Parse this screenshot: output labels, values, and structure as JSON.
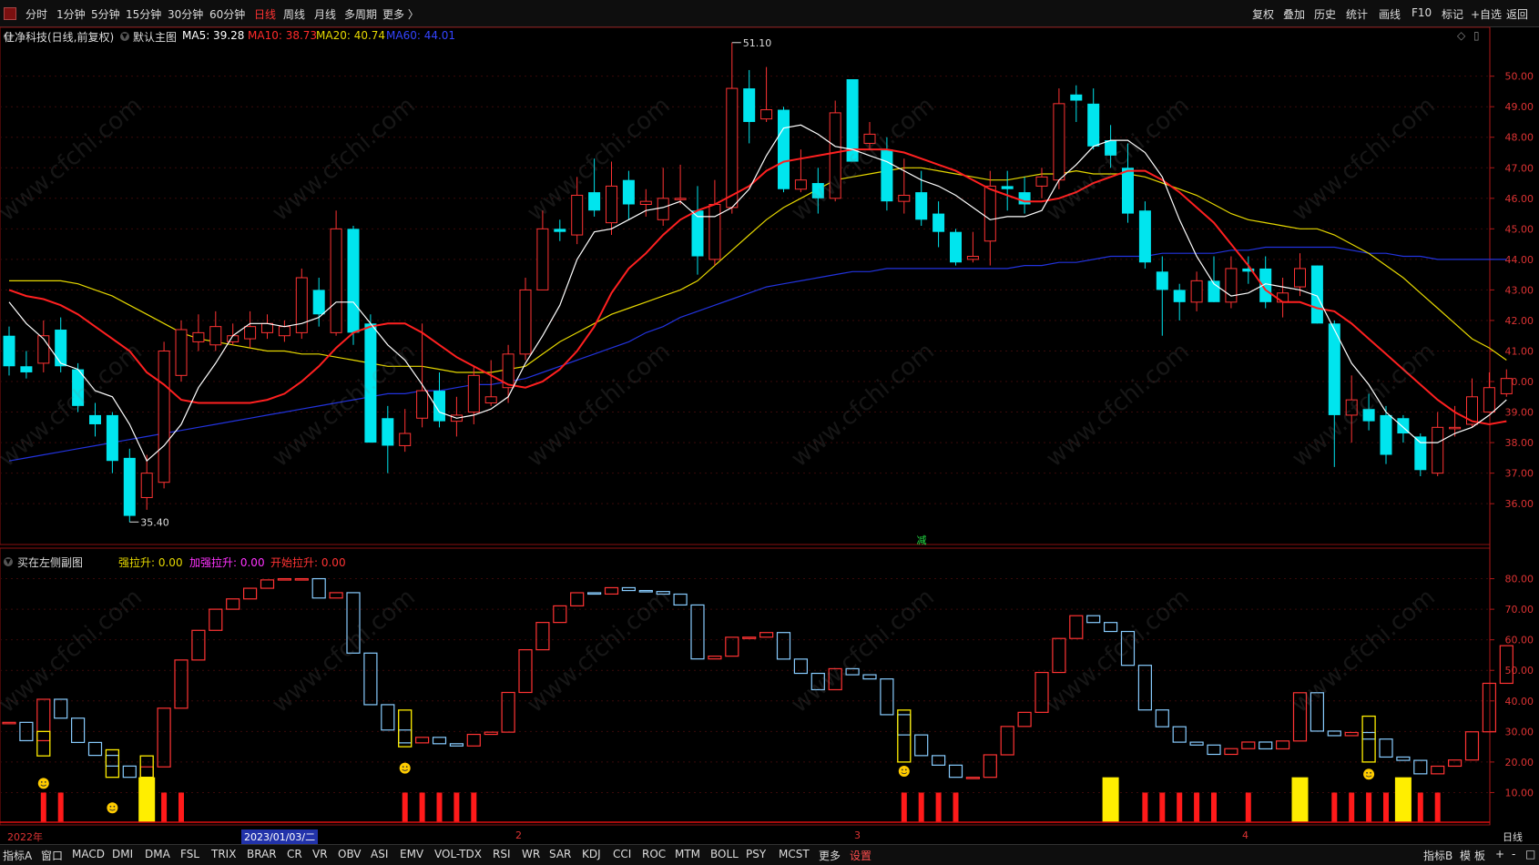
{
  "toolbar": {
    "periods": [
      "分时",
      "1分钟",
      "5分钟",
      "15分钟",
      "30分钟",
      "60分钟",
      "日线",
      "周线",
      "月线",
      "多周期",
      "更多 〉"
    ],
    "active_period": "日线",
    "right_buttons": [
      "复权",
      "叠加",
      "历史",
      "统计",
      "画线",
      "F10",
      "标记",
      "+自选",
      "返回"
    ]
  },
  "main_panel": {
    "stock_title": "仕净科技(日线,前复权)",
    "template": "默认主图",
    "ma5": "MA5: 39.28",
    "ma10": "MA10: 38.73",
    "ma20": "MA20: 40.74",
    "ma60": "MA60: 44.01",
    "high_label": "51.10",
    "low_label": "35.40",
    "marker": "减",
    "y_ticks": [
      "50.00",
      "49.00",
      "48.00",
      "47.00",
      "46.00",
      "45.00",
      "44.00",
      "43.00",
      "42.00",
      "41.00",
      "40.00",
      "39.00",
      "38.00",
      "37.00",
      "36.00"
    ]
  },
  "sub_panel": {
    "title": "买在左侧副图",
    "strong": "强拉升: 0.00",
    "accel": "加强拉升: 0.00",
    "start": "开始拉升: 0.00",
    "y_ticks": [
      "80.00",
      "70.00",
      "60.00",
      "50.00",
      "40.00",
      "30.00",
      "20.00",
      "10.00"
    ]
  },
  "date_axis": {
    "labels": [
      "2022年",
      "2023/01/03/二",
      "2",
      "3",
      "4"
    ],
    "right_label": "日线"
  },
  "bottom_tabs": {
    "items": [
      "指标A",
      "窗口",
      "MACD",
      "DMI",
      "DMA",
      "FSL",
      "TRIX",
      "BRAR",
      "CR",
      "VR",
      "OBV",
      "ASI",
      "EMV",
      "VOL-TDX",
      "RSI",
      "WR",
      "SAR",
      "KDJ",
      "CCI",
      "ROC",
      "MTM",
      "BOLL",
      "PSY",
      "MCST",
      "更多",
      "设置"
    ],
    "right_items": [
      "指标B",
      "模",
      "板",
      "+",
      "-",
      "□"
    ]
  },
  "colors": {
    "up": "#ff3333",
    "down": "#00e5ee",
    "ma5": "#ffffff",
    "ma10": "#ff2020",
    "ma20": "#e6d800",
    "ma60": "#2233dd"
  },
  "watermark": "www.cfchi.com",
  "chart_data": {
    "type": "candlestick",
    "candles": [
      [
        41.5,
        40.5,
        41.8,
        40.2
      ],
      [
        40.5,
        40.3,
        41.0,
        40.1
      ],
      [
        40.6,
        41.5,
        42.0,
        40.3
      ],
      [
        41.7,
        40.5,
        42.1,
        40.3
      ],
      [
        40.4,
        39.2,
        40.6,
        39.0
      ],
      [
        38.9,
        38.6,
        39.3,
        38.2
      ],
      [
        38.9,
        37.4,
        39.0,
        37.0
      ],
      [
        37.5,
        35.6,
        37.8,
        35.4
      ],
      [
        36.2,
        37.0,
        37.6,
        35.8
      ],
      [
        36.7,
        41.0,
        41.3,
        36.5
      ],
      [
        40.2,
        41.7,
        42.0,
        40.0
      ],
      [
        41.3,
        41.6,
        42.2,
        41.0
      ],
      [
        41.2,
        41.8,
        42.3,
        41.0
      ],
      [
        41.3,
        41.5,
        41.9,
        41.2
      ],
      [
        41.4,
        41.8,
        42.3,
        41.1
      ],
      [
        41.6,
        41.9,
        42.2,
        41.4
      ],
      [
        41.5,
        41.8,
        42.0,
        41.3
      ],
      [
        41.6,
        43.4,
        43.7,
        41.4
      ],
      [
        43.0,
        42.2,
        43.4,
        41.8
      ],
      [
        41.6,
        45.0,
        45.6,
        41.5
      ],
      [
        45.0,
        41.6,
        45.1,
        41.2
      ],
      [
        41.9,
        38.0,
        42.2,
        38.0
      ],
      [
        38.8,
        37.9,
        39.2,
        37.0
      ],
      [
        37.9,
        38.3,
        39.1,
        37.7
      ],
      [
        38.8,
        39.7,
        41.9,
        38.5
      ],
      [
        39.7,
        38.7,
        40.3,
        38.5
      ],
      [
        38.7,
        38.9,
        39.5,
        38.2
      ],
      [
        39.0,
        40.2,
        40.5,
        38.6
      ],
      [
        39.3,
        39.5,
        40.7,
        39.2
      ],
      [
        39.8,
        40.9,
        41.2,
        39.3
      ],
      [
        40.9,
        43.0,
        43.4,
        40.7
      ],
      [
        43.0,
        45.0,
        45.6,
        43.0
      ],
      [
        45.0,
        44.9,
        45.3,
        44.6
      ],
      [
        44.8,
        46.1,
        46.7,
        44.5
      ],
      [
        46.2,
        45.6,
        47.3,
        45.4
      ],
      [
        45.2,
        46.4,
        47.2,
        44.8
      ],
      [
        46.6,
        45.8,
        46.9,
        45.3
      ],
      [
        45.8,
        45.9,
        46.3,
        45.4
      ],
      [
        45.3,
        46.0,
        47.0,
        45.1
      ],
      [
        46.0,
        46.0,
        47.1,
        45.8
      ],
      [
        45.6,
        44.1,
        46.4,
        43.5
      ],
      [
        44.0,
        45.8,
        46.6,
        43.8
      ],
      [
        45.7,
        49.6,
        51.1,
        45.5
      ],
      [
        49.6,
        48.5,
        50.2,
        47.8
      ],
      [
        48.6,
        48.9,
        50.3,
        48.5
      ],
      [
        48.9,
        46.3,
        49.0,
        46.2
      ],
      [
        46.3,
        46.6,
        47.6,
        46.2
      ],
      [
        46.5,
        46.0,
        47.0,
        45.5
      ],
      [
        46.0,
        48.8,
        49.2,
        45.9
      ],
      [
        49.9,
        47.2,
        49.9,
        47.2
      ],
      [
        47.8,
        48.1,
        48.5,
        47.6
      ],
      [
        47.6,
        45.9,
        48.0,
        45.6
      ],
      [
        45.9,
        46.1,
        47.3,
        45.5
      ],
      [
        46.2,
        45.3,
        46.9,
        45.1
      ],
      [
        45.5,
        44.9,
        45.9,
        44.4
      ],
      [
        44.9,
        43.9,
        45.0,
        43.8
      ],
      [
        44.0,
        44.1,
        44.9,
        43.9
      ],
      [
        44.6,
        46.4,
        46.9,
        43.8
      ],
      [
        46.4,
        46.3,
        46.9,
        45.6
      ],
      [
        46.2,
        45.8,
        46.7,
        45.5
      ],
      [
        46.4,
        46.7,
        47.0,
        46.0
      ],
      [
        46.6,
        49.1,
        49.6,
        46.3
      ],
      [
        49.4,
        49.2,
        49.7,
        48.5
      ],
      [
        49.1,
        47.7,
        49.6,
        47.6
      ],
      [
        47.9,
        47.4,
        48.4,
        47.0
      ],
      [
        47.0,
        45.5,
        47.8,
        45.2
      ],
      [
        45.6,
        43.9,
        45.9,
        43.7
      ],
      [
        43.6,
        43.0,
        44.1,
        41.5
      ],
      [
        43.0,
        42.6,
        43.2,
        42.0
      ],
      [
        42.6,
        43.3,
        43.6,
        42.3
      ],
      [
        43.3,
        42.6,
        44.1,
        42.6
      ],
      [
        42.6,
        43.7,
        44.1,
        42.4
      ],
      [
        43.7,
        43.6,
        44.1,
        43.2
      ],
      [
        43.7,
        42.6,
        44.1,
        42.4
      ],
      [
        42.6,
        42.9,
        43.4,
        42.1
      ],
      [
        43.1,
        43.7,
        44.2,
        42.8
      ],
      [
        43.8,
        41.9,
        43.8,
        41.9
      ],
      [
        41.9,
        38.9,
        42.0,
        37.2
      ],
      [
        38.9,
        39.4,
        40.2,
        38.0
      ],
      [
        39.1,
        38.7,
        39.6,
        38.4
      ],
      [
        38.9,
        37.6,
        39.2,
        37.3
      ],
      [
        38.8,
        38.3,
        38.9,
        38.0
      ],
      [
        38.2,
        37.1,
        38.3,
        36.9
      ],
      [
        37.0,
        38.5,
        39.0,
        36.9
      ],
      [
        38.5,
        38.5,
        39.2,
        38.2
      ],
      [
        38.6,
        39.5,
        40.1,
        38.5
      ],
      [
        39.0,
        39.8,
        40.3,
        39.0
      ],
      [
        39.6,
        40.1,
        40.4,
        39.5
      ]
    ],
    "ma5": [
      42.6,
      41.9,
      41.4,
      40.6,
      40.4,
      39.7,
      39.5,
      38.6,
      37.4,
      37.9,
      38.6,
      39.8,
      40.6,
      41.5,
      41.9,
      41.9,
      41.8,
      41.9,
      42.1,
      42.6,
      42.6,
      41.9,
      41.2,
      40.7,
      39.9,
      39.0,
      38.8,
      38.9,
      39.1,
      39.5,
      40.6,
      41.5,
      42.5,
      44.0,
      44.9,
      45.0,
      45.3,
      45.6,
      45.7,
      45.9,
      45.4,
      45.4,
      45.7,
      46.3,
      47.4,
      48.3,
      48.4,
      48.1,
      47.7,
      47.6,
      47.4,
      47.2,
      46.9,
      46.6,
      46.4,
      46.1,
      45.7,
      45.3,
      45.4,
      45.4,
      45.6,
      46.6,
      47.1,
      47.7,
      47.9,
      47.9,
      47.5,
      46.7,
      45.3,
      44.1,
      43.2,
      42.8,
      42.9,
      43.2,
      43.1,
      43.0,
      42.8,
      41.7,
      40.6,
      39.9,
      39.0,
      38.5,
      38.0,
      38.0,
      38.3,
      38.5,
      38.9,
      39.4
    ],
    "ma10": [
      43.0,
      42.8,
      42.7,
      42.5,
      42.2,
      41.8,
      41.4,
      41.0,
      40.3,
      39.9,
      39.4,
      39.3,
      39.3,
      39.3,
      39.3,
      39.4,
      39.6,
      40.0,
      40.5,
      41.1,
      41.6,
      41.8,
      41.9,
      41.9,
      41.6,
      41.2,
      40.8,
      40.5,
      40.2,
      39.9,
      39.8,
      40.0,
      40.4,
      41.0,
      41.8,
      42.9,
      43.7,
      44.2,
      44.8,
      45.3,
      45.6,
      45.8,
      46.1,
      46.4,
      46.9,
      47.2,
      47.3,
      47.4,
      47.5,
      47.6,
      47.6,
      47.6,
      47.5,
      47.3,
      47.1,
      46.9,
      46.6,
      46.3,
      46.1,
      45.9,
      45.9,
      46.0,
      46.2,
      46.5,
      46.7,
      46.9,
      46.9,
      46.6,
      46.2,
      45.7,
      45.2,
      44.5,
      43.8,
      43.0,
      42.6,
      42.6,
      42.4,
      42.3,
      41.9,
      41.4,
      40.9,
      40.4,
      39.9,
      39.4,
      39.0,
      38.7,
      38.6,
      38.7
    ],
    "ma20": [
      43.3,
      43.3,
      43.3,
      43.3,
      43.2,
      43.0,
      42.8,
      42.5,
      42.2,
      41.9,
      41.6,
      41.4,
      41.3,
      41.2,
      41.1,
      41.0,
      41.0,
      40.9,
      40.9,
      40.8,
      40.7,
      40.6,
      40.5,
      40.5,
      40.5,
      40.4,
      40.3,
      40.3,
      40.3,
      40.4,
      40.5,
      40.9,
      41.3,
      41.6,
      41.9,
      42.2,
      42.4,
      42.6,
      42.8,
      43.0,
      43.3,
      43.8,
      44.3,
      44.8,
      45.3,
      45.7,
      46.0,
      46.3,
      46.6,
      46.7,
      46.8,
      46.9,
      47.0,
      47.0,
      46.9,
      46.8,
      46.7,
      46.6,
      46.6,
      46.7,
      46.8,
      46.8,
      46.9,
      46.8,
      46.8,
      46.8,
      46.7,
      46.5,
      46.3,
      46.1,
      45.8,
      45.5,
      45.3,
      45.2,
      45.1,
      45.0,
      45.0,
      44.8,
      44.5,
      44.2,
      43.8,
      43.4,
      42.9,
      42.4,
      41.9,
      41.4,
      41.1,
      40.7
    ],
    "ma60": [
      37.4,
      37.5,
      37.6,
      37.7,
      37.8,
      37.9,
      38.0,
      38.1,
      38.2,
      38.3,
      38.4,
      38.5,
      38.6,
      38.7,
      38.8,
      38.9,
      39.0,
      39.1,
      39.2,
      39.3,
      39.4,
      39.5,
      39.6,
      39.6,
      39.7,
      39.7,
      39.8,
      39.9,
      39.9,
      40.0,
      40.1,
      40.3,
      40.5,
      40.7,
      40.9,
      41.1,
      41.3,
      41.6,
      41.8,
      42.1,
      42.3,
      42.5,
      42.7,
      42.9,
      43.1,
      43.2,
      43.3,
      43.4,
      43.5,
      43.6,
      43.6,
      43.7,
      43.7,
      43.7,
      43.7,
      43.7,
      43.7,
      43.7,
      43.7,
      43.8,
      43.8,
      43.9,
      43.9,
      44.0,
      44.1,
      44.1,
      44.1,
      44.2,
      44.2,
      44.2,
      44.2,
      44.3,
      44.3,
      44.4,
      44.4,
      44.4,
      44.4,
      44.4,
      44.3,
      44.2,
      44.2,
      44.1,
      44.1,
      44.0,
      44.0,
      44.0,
      44.0,
      44.0
    ]
  }
}
